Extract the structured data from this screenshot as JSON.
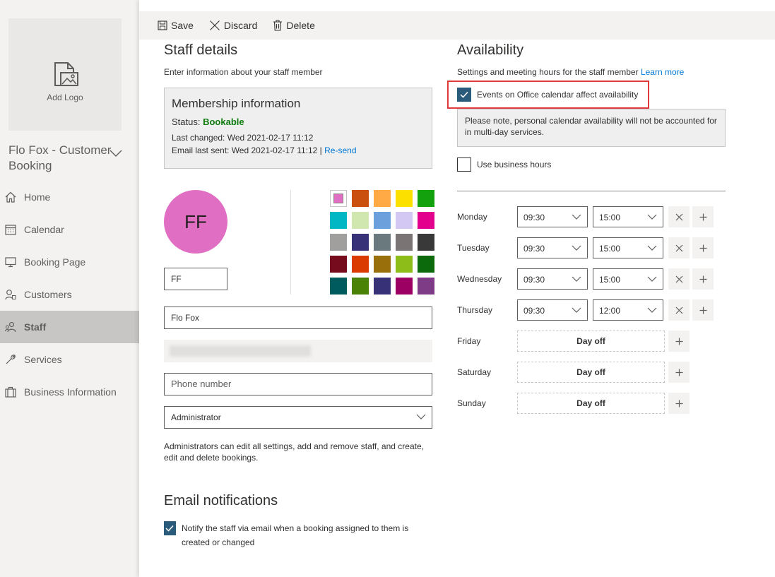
{
  "sidebar": {
    "logo_label": "Add Logo",
    "business_name": "Flo Fox - Customer Booking",
    "items": [
      {
        "label": "Home",
        "icon": "home-icon"
      },
      {
        "label": "Calendar",
        "icon": "calendar-icon"
      },
      {
        "label": "Booking Page",
        "icon": "monitor-icon"
      },
      {
        "label": "Customers",
        "icon": "customers-icon"
      },
      {
        "label": "Staff",
        "icon": "staff-icon",
        "active": true
      },
      {
        "label": "Services",
        "icon": "wrench-icon"
      },
      {
        "label": "Business Information",
        "icon": "briefcase-icon"
      }
    ]
  },
  "toolbar": {
    "save_label": "Save",
    "discard_label": "Discard",
    "delete_label": "Delete"
  },
  "staff": {
    "title": "Staff details",
    "subtitle": "Enter information about your staff member",
    "membership": {
      "title": "Membership information",
      "status_label": "Status:",
      "status_value": "Bookable",
      "last_changed": "Last changed: Wed 2021-02-17 11:12",
      "email_last_sent": "Email last sent: Wed 2021-02-17 11:12 |",
      "resend_label": "Re-send"
    },
    "avatar_initials": "FF",
    "initials_value": "FF",
    "colors": [
      "#e06ec3",
      "#ca5010",
      "#ffaa44",
      "#fce100",
      "#13a10e",
      "#00b7c3",
      "#d0e7b0",
      "#6ca0dc",
      "#d3c8f3",
      "#e3008c",
      "#a19f9d",
      "#373277",
      "#69797e",
      "#7a7574",
      "#393939",
      "#750b1c",
      "#da3b01",
      "#986f0b",
      "#8cbd18",
      "#0b6a0b",
      "#005b5e",
      "#498205",
      "#373277",
      "#9b0062",
      "#7e3c86"
    ],
    "name_value": "Flo Fox",
    "phone_placeholder": "Phone number",
    "role_value": "Administrator",
    "role_note": "Administrators can edit all settings, add and remove staff, and create, edit and delete bookings.",
    "email_title": "Email notifications",
    "notify_label": "Notify the staff via email when a booking assigned to them is created or changed"
  },
  "availability": {
    "title": "Availability",
    "description": "Settings and meeting hours for the staff member",
    "learn_more": "Learn more",
    "office_calendar_label": "Events on Office calendar affect availability",
    "note": "Please note, personal calendar availability will not be accounted for in multi-day services.",
    "business_hours_label": "Use business hours",
    "days": [
      {
        "day": "Monday",
        "start": "09:30",
        "end": "15:00"
      },
      {
        "day": "Tuesday",
        "start": "09:30",
        "end": "15:00"
      },
      {
        "day": "Wednesday",
        "start": "09:30",
        "end": "15:00"
      },
      {
        "day": "Thursday",
        "start": "09:30",
        "end": "12:00"
      },
      {
        "day": "Friday",
        "off": "Day off"
      },
      {
        "day": "Saturday",
        "off": "Day off"
      },
      {
        "day": "Sunday",
        "off": "Day off"
      }
    ]
  }
}
